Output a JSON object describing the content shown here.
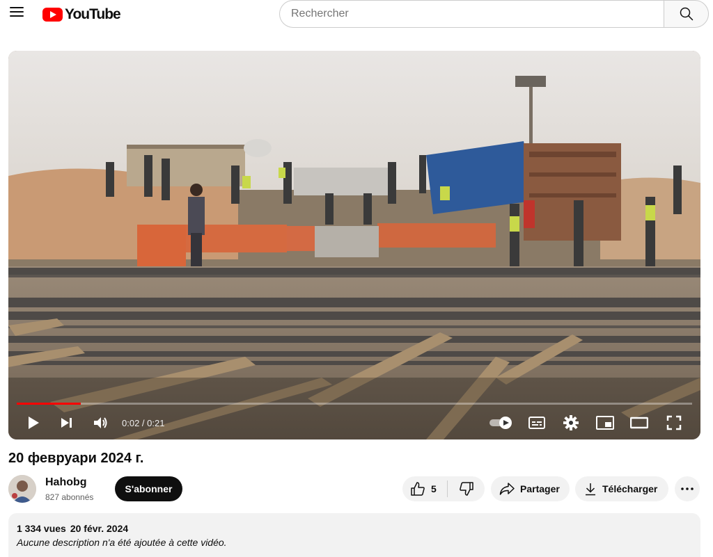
{
  "header": {
    "logo_text": "YouTube",
    "search_placeholder": "Rechercher"
  },
  "player": {
    "current_time": "0:02",
    "duration": "0:21",
    "time_display": "0:02 / 0:21",
    "progress_fraction": 0.095
  },
  "video": {
    "title": "20 февруари 2024 г."
  },
  "channel": {
    "name": "Hahobg",
    "subscribers": "827 abonnés",
    "subscribe_label": "S'abonner"
  },
  "actions": {
    "like_count": "5",
    "share_label": "Partager",
    "download_label": "Télécharger"
  },
  "description": {
    "views": "1 334 vues",
    "date": "20 févr. 2024",
    "text": "Aucune description n'a été ajoutée à cette vidéo."
  },
  "colors": {
    "brand_red": "#ff0000",
    "pill_bg": "#f2f2f2",
    "subscribe_bg": "#0f0f0f"
  }
}
